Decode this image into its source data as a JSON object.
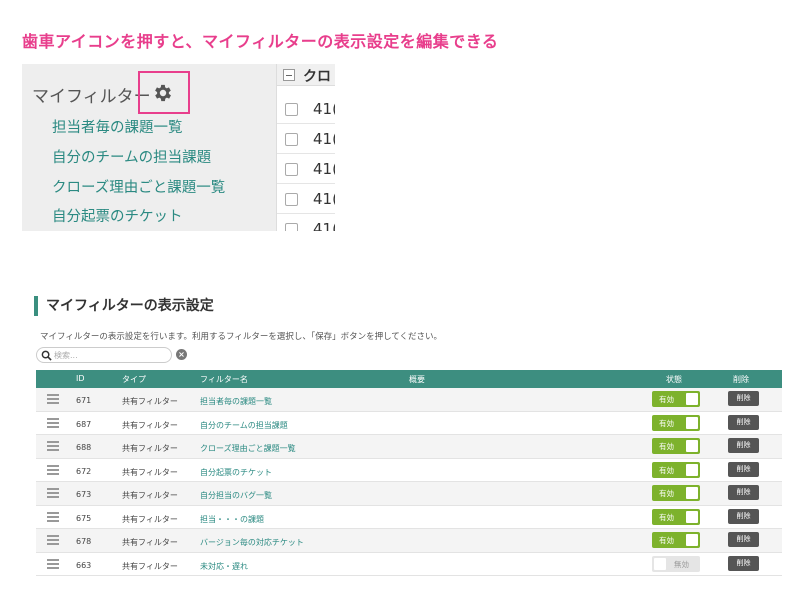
{
  "headline": "歯車アイコンを押すと、マイフィルターの表示設定を編集できる",
  "crop": {
    "sidebar_title": "マイフィルター",
    "links": [
      "担当者毎の課題一覧",
      "自分のチームの担当課題",
      "クローズ理由ごと課題一覧",
      "自分起票のチケット"
    ],
    "list_header": "クロ",
    "row_numbers": [
      "41(",
      "41(",
      "41(",
      "41(",
      "41("
    ]
  },
  "section": {
    "title": "マイフィルターの表示設定",
    "description": "マイフィルターの表示設定を行います。利用するフィルターを選択し、「保存」ボタンを押してください。"
  },
  "search": {
    "placeholder": "検索..."
  },
  "table": {
    "headers": {
      "id": "ID",
      "type": "タイプ",
      "name": "フィルター名",
      "summary": "概要",
      "status": "状態",
      "delete": "削除"
    },
    "rows": [
      {
        "id": "671",
        "type": "共有フィルター",
        "name": "担当者毎の課題一覧",
        "status": "有効",
        "enabled": true,
        "delete": "削除"
      },
      {
        "id": "687",
        "type": "共有フィルター",
        "name": "自分のチームの担当課題",
        "status": "有効",
        "enabled": true,
        "delete": "削除"
      },
      {
        "id": "688",
        "type": "共有フィルター",
        "name": "クローズ理由ごと課題一覧",
        "status": "有効",
        "enabled": true,
        "delete": "削除"
      },
      {
        "id": "672",
        "type": "共有フィルター",
        "name": "自分起票のチケット",
        "status": "有効",
        "enabled": true,
        "delete": "削除"
      },
      {
        "id": "673",
        "type": "共有フィルター",
        "name": "自分担当のバグ一覧",
        "status": "有効",
        "enabled": true,
        "delete": "削除"
      },
      {
        "id": "675",
        "type": "共有フィルター",
        "name": "担当・・・の課題",
        "status": "有効",
        "enabled": true,
        "delete": "削除"
      },
      {
        "id": "678",
        "type": "共有フィルター",
        "name": "バージョン毎の対応チケット",
        "status": "有効",
        "enabled": true,
        "delete": "削除"
      },
      {
        "id": "663",
        "type": "共有フィルター",
        "name": "未対応・遅れ",
        "status": "無効",
        "enabled": false,
        "delete": "削除"
      }
    ]
  },
  "colors": {
    "accent": "#e83e8c",
    "header": "#3d8e80",
    "link": "#2b8a82",
    "toggle_on": "#7db22c",
    "delete": "#555555"
  }
}
